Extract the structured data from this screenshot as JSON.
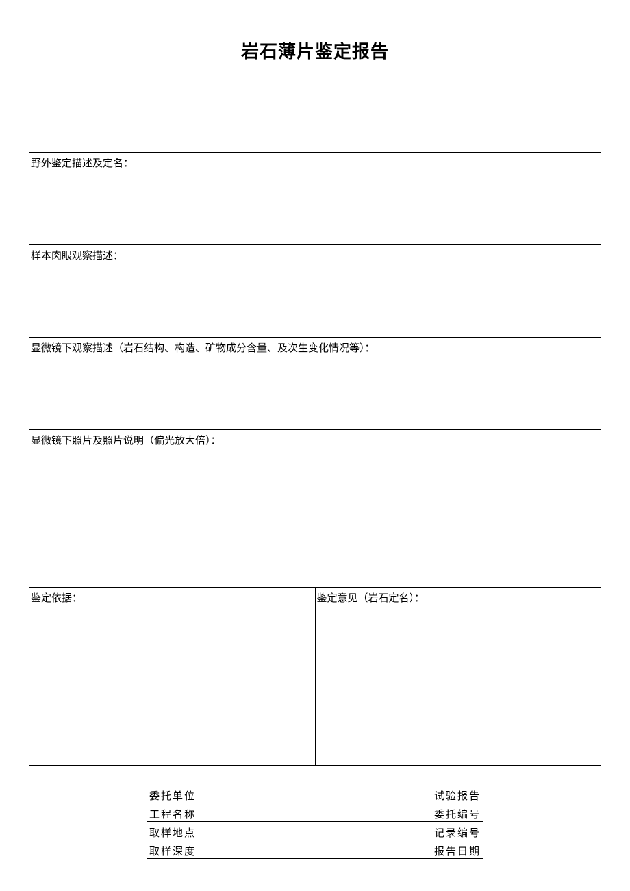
{
  "title": "岩石薄片鉴定报告",
  "sections": {
    "field_desc": "野外鉴定描述及定名：",
    "sample_desc": "样本肉眼观察描述：",
    "micro_desc": "显微镜下观察描述（岩石结构、构造、矿物成分含量、及次生变化情况等）：",
    "photo_desc": "显微镜下照片及照片说明（偏光放大倍）：",
    "basis": "鉴定依据：",
    "opinion": "鉴定意见（岩石定名）："
  },
  "footer": {
    "row1_left": "委托单位",
    "row1_right": "试验报告",
    "row2_left": "工程名称",
    "row2_right": "委托编号",
    "row3_left": "取样地点",
    "row3_right": "记录编号",
    "row4_left": "取样深度",
    "row4_right": "报告日期"
  }
}
